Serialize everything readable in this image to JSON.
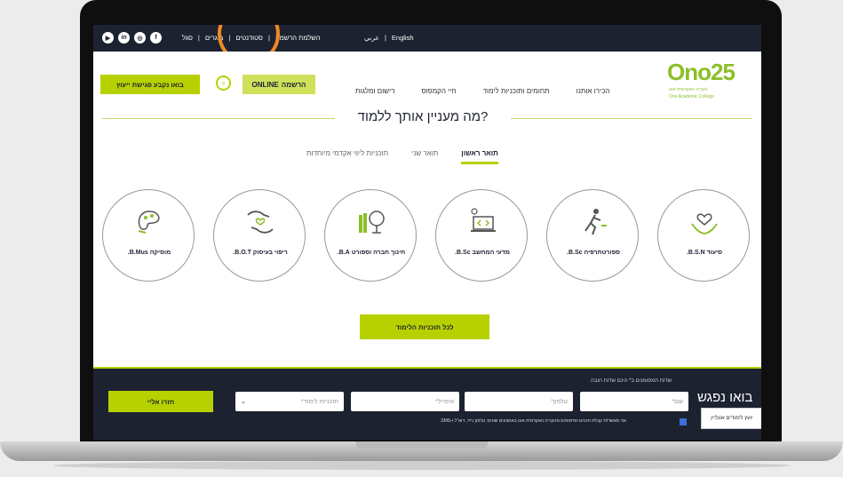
{
  "topbar": {
    "social": [
      {
        "icon": "youtube-icon",
        "glyph": "▶"
      },
      {
        "icon": "linkedin-icon",
        "glyph": "in"
      },
      {
        "icon": "instagram-icon",
        "glyph": "◎"
      },
      {
        "icon": "facebook-icon",
        "glyph": "f"
      }
    ],
    "links": [
      "השלמת הרשמה",
      "סטודנטים",
      "בוגרים",
      "סגל"
    ],
    "separator": "|",
    "lang": {
      "en": "English",
      "ar": "عربي"
    }
  },
  "nav": {
    "cta_label": "בואו נקבע פגישת ייעוץ",
    "online_text": "ONLINE",
    "online_bold": "הרשמה",
    "menu": [
      "הכירו אותנו",
      "תחומים ותוכניות לימוד",
      "חיי הקמפוס",
      "רישום ומלגות"
    ],
    "logo": {
      "brand": "Ono25",
      "sub_he": "הקריה האקדמית אונו",
      "sub_en": "Ono Academic College"
    }
  },
  "main": {
    "heading": "מה מעניין אותך ללמוד?",
    "tabs": [
      {
        "label": "תואר ראשון",
        "active": true
      },
      {
        "label": "תואר שני",
        "active": false
      },
      {
        "label": "תוכניות ליווי אקדמי מיוחדות",
        "active": false
      }
    ],
    "programs": [
      {
        "label": "סיעוד B.S.N.",
        "icon": "hands-heart-icon"
      },
      {
        "label": "ספורטתרפיה B.Sc.",
        "icon": "runner-icon"
      },
      {
        "label": "מדעי המחשב B.Sc.",
        "icon": "laptop-code-icon"
      },
      {
        "label": "חינוך חברה וספורט B.A.",
        "icon": "books-globe-icon"
      },
      {
        "label": "ריפוי בעיסוק B.O.T.",
        "icon": "hands-support-icon"
      },
      {
        "label": "מוסיקה B.Mus.",
        "icon": "music-palette-icon"
      }
    ],
    "all_programs_label": "לכל תוכניות הלימוד"
  },
  "footer": {
    "hint": "שדות המסומנים ב* הינם שדות חובה",
    "meet": "בואו נפגש",
    "name_placeholder": "שם*",
    "phone_placeholder": "טלפון*",
    "email_placeholder": "אימייל*",
    "program_placeholder": "תוכניות לימוד*",
    "back_label": "חזרו אליי",
    "consent": "אני מאשר/ת קבלת תכנים ופרסומים מהקריה האקדמית אונו באמצעים שונים: טלפון נייד, דוא\"ל ו-SMS.",
    "chat_label": "יועץ לימודים אונליין"
  },
  "colors": {
    "accent": "#b7d100",
    "dark": "#1d2231",
    "highlight": "#f08a24"
  }
}
